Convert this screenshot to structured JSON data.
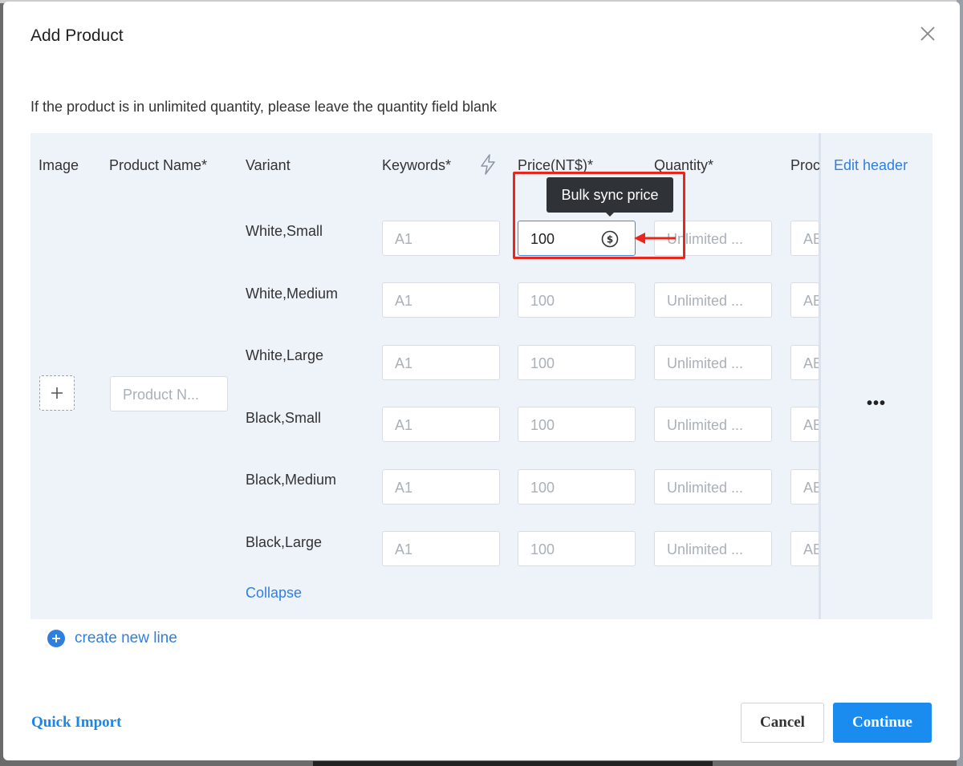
{
  "dialog": {
    "title": "Add Product",
    "hint": "If the product is in unlimited quantity, please leave the quantity field blank"
  },
  "table": {
    "headers": {
      "image": "Image",
      "product_name": "Product Name*",
      "variant": "Variant",
      "keywords": "Keywords*",
      "price": "Price(NT$)*",
      "quantity": "Quantity*",
      "product_code": "Proc",
      "edit_header": "Edit header"
    },
    "product_name_placeholder": "Product N...",
    "rows": [
      {
        "variant": "White,Small",
        "keywords": "A1",
        "price": "100",
        "quantity": "Unlimited ...",
        "code": "AE"
      },
      {
        "variant": "White,Medium",
        "keywords": "A1",
        "price": "100",
        "quantity": "Unlimited ...",
        "code": "AE"
      },
      {
        "variant": "White,Large",
        "keywords": "A1",
        "price": "100",
        "quantity": "Unlimited ...",
        "code": "AE"
      },
      {
        "variant": "Black,Small",
        "keywords": "A1",
        "price": "100",
        "quantity": "Unlimited ...",
        "code": "AE"
      },
      {
        "variant": "Black,Medium",
        "keywords": "A1",
        "price": "100",
        "quantity": "Unlimited ...",
        "code": "AE"
      },
      {
        "variant": "Black,Large",
        "keywords": "A1",
        "price": "100",
        "quantity": "Unlimited ...",
        "code": "AE"
      }
    ],
    "collapse": "Collapse",
    "more": "•••"
  },
  "tooltip": "Bulk sync price",
  "create_line": "create new line",
  "footer": {
    "quick_import": "Quick Import",
    "cancel": "Cancel",
    "continue": "Continue"
  },
  "colors": {
    "accent": "#2f7fe0",
    "primary_button": "#1a8cf0",
    "highlight": "#e8261c"
  }
}
